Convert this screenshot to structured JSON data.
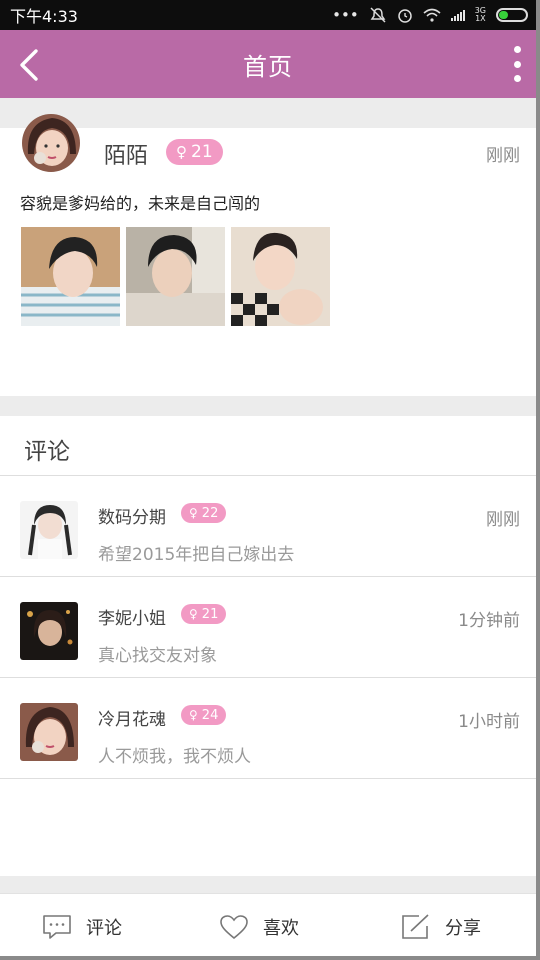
{
  "status_bar": {
    "time": "下午4:33",
    "network": "3G",
    "network_sub": "1X"
  },
  "header": {
    "title": "首页"
  },
  "post": {
    "name": "陌陌",
    "gender_symbol": "♀",
    "age": "21",
    "time": "刚刚",
    "text": "容貌是爹妈给的，未来是自己闯的",
    "photo_count": 3
  },
  "comments": {
    "title": "评论",
    "items": [
      {
        "name": "数码分期",
        "gender_symbol": "♀",
        "age": "22",
        "time": "刚刚",
        "message": "希望2015年把自己嫁出去"
      },
      {
        "name": "李妮小姐",
        "gender_symbol": "♀",
        "age": "21",
        "time": "1分钟前",
        "message": "真心找交友对象"
      },
      {
        "name": "冷月花魂",
        "gender_symbol": "♀",
        "age": "24",
        "time": "1小时前",
        "message": "人不烦我，我不烦人"
      }
    ]
  },
  "bottom_bar": {
    "comment_label": "评论",
    "like_label": "喜欢",
    "share_label": "分享"
  },
  "colors": {
    "header": "#b96aa6",
    "tag": "#f29ac4",
    "divider": "#ececec",
    "battery": "#37d03a"
  },
  "icons": [
    "back-arrow-icon",
    "more-vert-icon",
    "comment-icon",
    "heart-icon",
    "share-icon"
  ],
  "battery_level": 0.35
}
